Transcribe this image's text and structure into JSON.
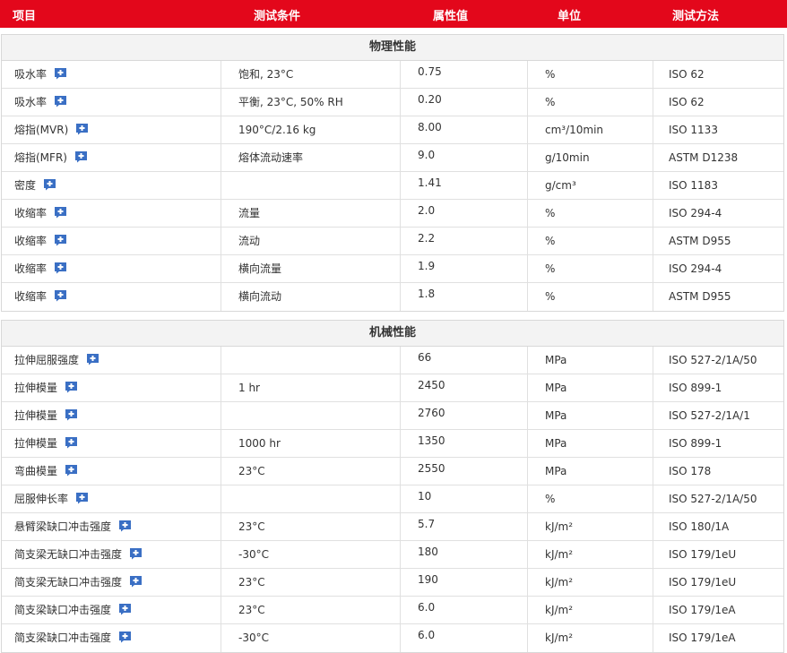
{
  "header": {
    "item": "项目",
    "condition": "测试条件",
    "value": "属性值",
    "unit": "单位",
    "method": "测试方法"
  },
  "colors": {
    "header_bg": "#e3071b",
    "plus_icon": "#3a6fc4"
  },
  "sections": [
    {
      "title": "物理性能",
      "rows": [
        {
          "name": "吸水率",
          "condition": "饱和, 23°C",
          "value": "0.75",
          "unit": "%",
          "method": "ISO 62"
        },
        {
          "name": "吸水率",
          "condition": "平衡, 23°C, 50% RH",
          "value": "0.20",
          "unit": "%",
          "method": "ISO 62"
        },
        {
          "name": "熔指(MVR)",
          "condition": "190°C/2.16 kg",
          "value": "8.00",
          "unit": "cm³/10min",
          "method": "ISO 1133"
        },
        {
          "name": "熔指(MFR)",
          "condition": "熔体流动速率",
          "value": "9.0",
          "unit": "g/10min",
          "method": "ASTM D1238"
        },
        {
          "name": "密度",
          "condition": "",
          "value": "1.41",
          "unit": "g/cm³",
          "method": "ISO 1183"
        },
        {
          "name": "收缩率",
          "condition": "流量",
          "value": "2.0",
          "unit": "%",
          "method": "ISO 294-4"
        },
        {
          "name": "收缩率",
          "condition": "流动",
          "value": "2.2",
          "unit": "%",
          "method": "ASTM D955"
        },
        {
          "name": "收缩率",
          "condition": "横向流量",
          "value": "1.9",
          "unit": "%",
          "method": "ISO 294-4"
        },
        {
          "name": "收缩率",
          "condition": "横向流动",
          "value": "1.8",
          "unit": "%",
          "method": "ASTM D955"
        }
      ]
    },
    {
      "title": "机械性能",
      "rows": [
        {
          "name": "拉伸屈服强度",
          "condition": "",
          "value": "66",
          "unit": "MPa",
          "method": "ISO 527-2/1A/50"
        },
        {
          "name": "拉伸模量",
          "condition": "1 hr",
          "value": "2450",
          "unit": "MPa",
          "method": "ISO 899-1"
        },
        {
          "name": "拉伸模量",
          "condition": "",
          "value": "2760",
          "unit": "MPa",
          "method": "ISO 527-2/1A/1"
        },
        {
          "name": "拉伸模量",
          "condition": "1000 hr",
          "value": "1350",
          "unit": "MPa",
          "method": "ISO 899-1"
        },
        {
          "name": "弯曲模量",
          "condition": "23°C",
          "value": "2550",
          "unit": "MPa",
          "method": "ISO 178"
        },
        {
          "name": "屈服伸长率",
          "condition": "",
          "value": "10",
          "unit": "%",
          "method": "ISO 527-2/1A/50"
        },
        {
          "name": "悬臂梁缺口冲击强度",
          "condition": "23°C",
          "value": "5.7",
          "unit": "kJ/m²",
          "method": "ISO 180/1A"
        },
        {
          "name": "简支梁无缺口冲击强度",
          "condition": "-30°C",
          "value": "180",
          "unit": "kJ/m²",
          "method": "ISO 179/1eU"
        },
        {
          "name": "简支梁无缺口冲击强度",
          "condition": "23°C",
          "value": "190",
          "unit": "kJ/m²",
          "method": "ISO 179/1eU"
        },
        {
          "name": "简支梁缺口冲击强度",
          "condition": "23°C",
          "value": "6.0",
          "unit": "kJ/m²",
          "method": "ISO 179/1eA"
        },
        {
          "name": "简支梁缺口冲击强度",
          "condition": "-30°C",
          "value": "6.0",
          "unit": "kJ/m²",
          "method": "ISO 179/1eA"
        }
      ]
    }
  ]
}
